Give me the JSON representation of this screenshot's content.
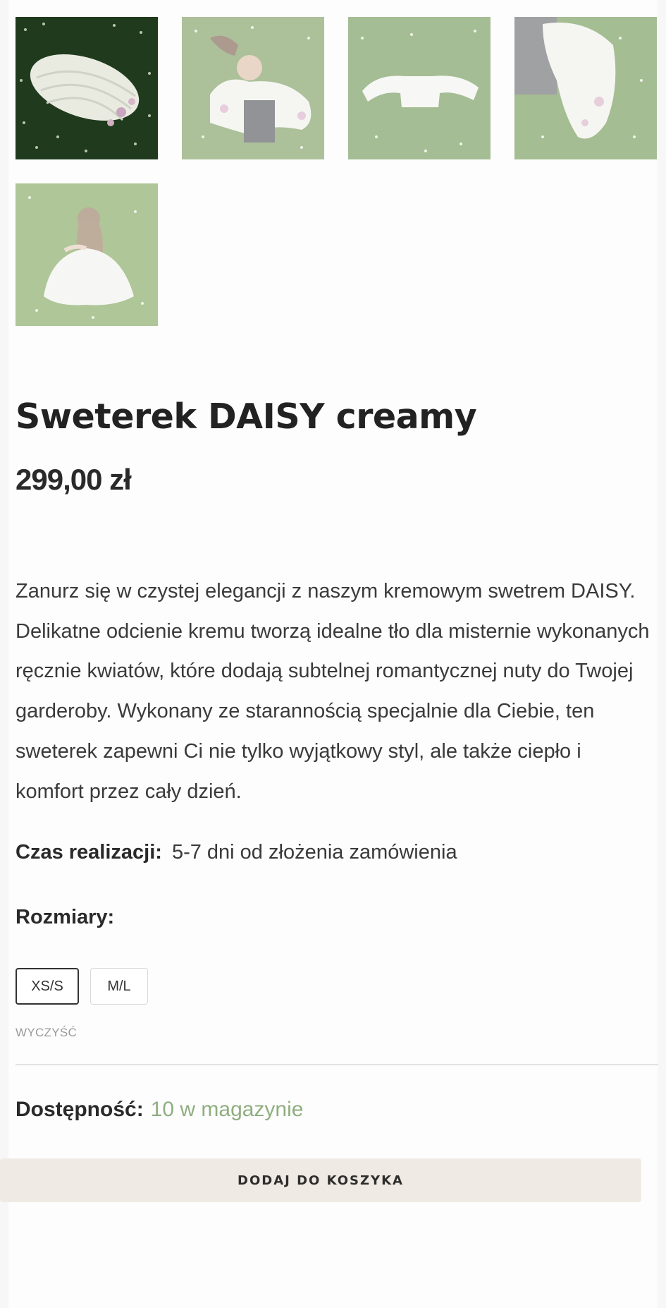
{
  "gallery": {
    "thumbnails": [
      {
        "alt": "sweater-on-grass-folded",
        "active": true
      },
      {
        "alt": "woman-lying-in-sweater",
        "active": false
      },
      {
        "alt": "sweater-flat-on-grass",
        "active": false
      },
      {
        "alt": "sweater-sleeve-detail",
        "active": false
      },
      {
        "alt": "woman-sitting-back-view",
        "active": false
      }
    ]
  },
  "product": {
    "title": "Sweterek DAISY creamy",
    "price": "299,00 zł",
    "description": "Zanurz się w czystej elegancji z naszym kremowym swetrem DAISY. Delikatne odcienie kremu tworzą idealne tło dla misternie wykonanych ręcznie kwiatów, które dodają subtelnej romantycznej nuty do Twojej garderoby. Wykonany ze starannością specjalnie dla Ciebie, ten sweterek zapewni Ci nie tylko wyjątkowy styl, ale także ciepło i komfort przez cały dzień.",
    "lead_time_label": "Czas realizacji:",
    "lead_time_value": "5-7 dni od złożenia zamówienia",
    "sizes_label": "Rozmiary:",
    "sizes": [
      "XS/S",
      "M/L"
    ],
    "selected_size": "XS/S",
    "clear_label": "WYCZYŚĆ",
    "availability_label": "Dostępność:",
    "availability_value": "10 w magazynie",
    "add_to_cart_label": "DODAJ DO KOSZYKA"
  },
  "colors": {
    "stock_green": "#8fae7f",
    "cart_button_bg": "#efebe4"
  }
}
